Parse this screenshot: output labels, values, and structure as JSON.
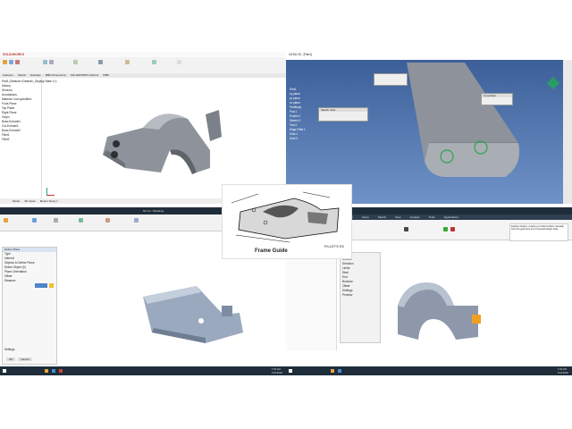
{
  "center_figure": {
    "caption": "Frame Guide",
    "annotation": "FILLETS R2"
  },
  "q1": {
    "app": "SOLIDWORKS",
    "tabs": [
      "Features",
      "Sketch",
      "Evaluate",
      "MBD Dimensions",
      "SOLIDWORKS Add-Ins",
      "MBD"
    ],
    "tree": [
      "Part1 (Default<<Default>_Display State 1>)",
      "History",
      "Sensors",
      "Annotations",
      "Material <not specified>",
      "Front Plane",
      "Top Plane",
      "Right Plane",
      "Origin",
      "Boss-Extrude1",
      "Cut-Extrude1",
      "Boss-Extrude2",
      "Fillet1",
      "Fillet2"
    ],
    "bottom_tabs": [
      "Model",
      "3D Views",
      "Motion Study 1"
    ]
  },
  "q2": {
    "title": "CATIA V5 - [Part1]",
    "tree": [
      "Part1",
      "xy plane",
      "yz plane",
      "zx plane",
      "PartBody",
      "Pad.1",
      "Pocket.1",
      "Sketch.2",
      "Pad.2",
      "Edge Fillet.1",
      "Hole.1",
      "Hole.2"
    ],
    "dialog1_title": "Sketch tools",
    "dialog2_title": "Constraint"
  },
  "q3": {
    "title": "NX 12 - Modeling",
    "panel_title": "Datum Plane",
    "panel_rows": [
      "Type",
      "Inferred",
      "Objects to Define Plane",
      "Select Object (0)",
      "Plane Orientation",
      "Offset",
      "Distance",
      "Settings"
    ],
    "ok_label": "OK",
    "cancel_label": "Cancel"
  },
  "q4": {
    "tabs": [
      "File",
      "Home",
      "Sketch",
      "View",
      "Analysis",
      "Tools",
      "Applications"
    ],
    "panel_rows": [
      "Extrude",
      "Section",
      "Direction",
      "Limits",
      "Start",
      "End",
      "Boolean",
      "Offset",
      "Settings",
      "Preview"
    ],
    "info_text": "Explore shapes, creating a model surface manually from the geometry at an imported shape body."
  },
  "taskbar": {
    "clock_left": "7:20 AM",
    "date_left": "7/16/2020",
    "clock_right": "7:20 AM",
    "date_right": "7/16/2020"
  },
  "colors": {
    "part_grey": "#8e939b",
    "catia_bg": "#4d73ae",
    "taskbar": "#1f2d3a",
    "highlight_orange": "#f0a020"
  }
}
